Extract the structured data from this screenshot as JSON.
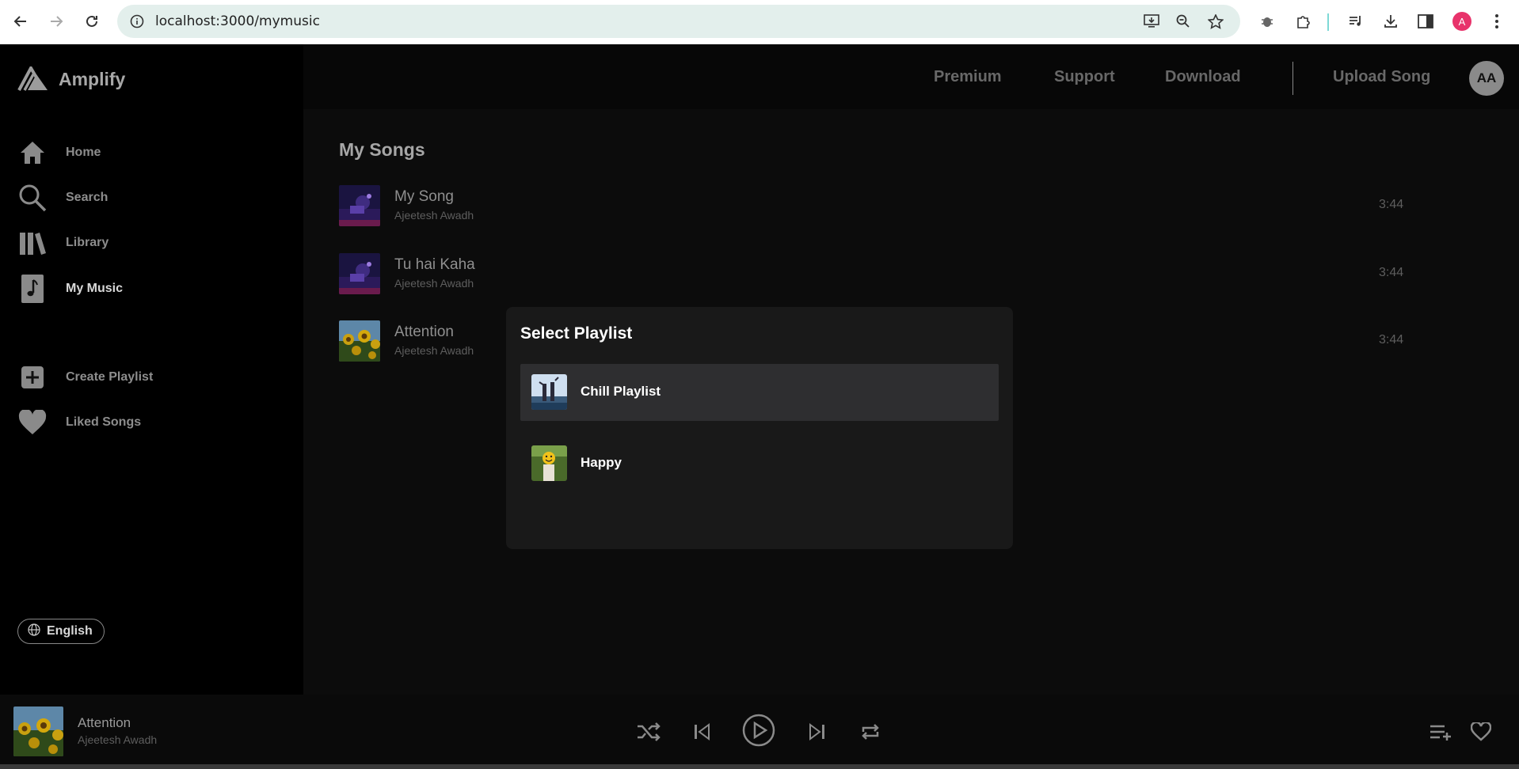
{
  "browser": {
    "url": "localhost:3000/mymusic",
    "profile_initial": "A"
  },
  "app": {
    "name": "Amplify",
    "nav": [
      {
        "label": "Home"
      },
      {
        "label": "Search"
      },
      {
        "label": "Library"
      },
      {
        "label": "My Music"
      }
    ],
    "actions": [
      {
        "label": "Create Playlist"
      },
      {
        "label": "Liked Songs"
      }
    ],
    "language": "English"
  },
  "header": {
    "links": [
      "Premium",
      "Support",
      "Download"
    ],
    "upload": "Upload Song",
    "avatar_initials": "AA"
  },
  "main": {
    "title": "My Songs",
    "songs": [
      {
        "title": "My Song",
        "artist": "Ajeetesh Awadh",
        "duration": "3:44"
      },
      {
        "title": "Tu hai Kaha",
        "artist": "Ajeetesh Awadh",
        "duration": "3:44"
      },
      {
        "title": "Attention",
        "artist": "Ajeetesh Awadh",
        "duration": "3:44"
      }
    ]
  },
  "modal": {
    "title": "Select Playlist",
    "playlists": [
      {
        "name": "Chill Playlist"
      },
      {
        "name": "Happy"
      }
    ]
  },
  "player": {
    "title": "Attention",
    "artist": "Ajeetesh Awadh"
  }
}
